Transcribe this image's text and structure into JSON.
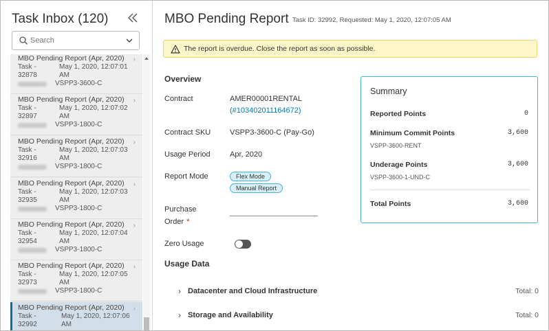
{
  "sidebar": {
    "title": "Task Inbox (120)",
    "collapse_icon": "double-chevron-left-icon",
    "search": {
      "placeholder": "Search",
      "value": ""
    },
    "tasks": [
      {
        "title": "MBO Pending Report (Apr, 2020)",
        "task": "Task - 32878",
        "date": "May 1, 2020, 12:07:01 AM",
        "sku": "VSPP3-3600-C",
        "active": false
      },
      {
        "title": "MBO Pending Report (Apr, 2020)",
        "task": "Task - 32897",
        "date": "May 1, 2020, 12:07:02 AM",
        "sku": "VSPP3-1800-C",
        "active": false
      },
      {
        "title": "MBO Pending Report (Apr, 2020)",
        "task": "Task - 32916",
        "date": "May 1, 2020, 12:07:03 AM",
        "sku": "VSPP3-1800-C",
        "active": false
      },
      {
        "title": "MBO Pending Report (Apr, 2020)",
        "task": "Task - 32935",
        "date": "May 1, 2020, 12:07:03 AM",
        "sku": "VSPP3-1800-C",
        "active": false
      },
      {
        "title": "MBO Pending Report (Apr, 2020)",
        "task": "Task - 32954",
        "date": "May 1, 2020, 12:07:04 AM",
        "sku": "VSPP3-1800-C",
        "active": false
      },
      {
        "title": "MBO Pending Report (Apr, 2020)",
        "task": "Task - 32973",
        "date": "May 1, 2020, 12:07:05 AM",
        "sku": "VSPP3-1800-C",
        "active": false
      },
      {
        "title": "MBO Pending Report (Apr, 2020)",
        "task": "Task - 32992",
        "date": "May 1, 2020, 12:07:06 AM",
        "sku": "",
        "active": true
      }
    ]
  },
  "main": {
    "title": "MBO Pending Report",
    "meta": "Task ID: 32992, Requested: May 1, 2020, 12:07:05 AM",
    "alert": "The report is overdue. Close the report as soon as possible.",
    "overview": {
      "title": "Overview",
      "contract_label": "Contract",
      "contract_value": "AMER00001RENTAL",
      "contract_link": "(#103402011164672)",
      "sku_label": "Contract SKU",
      "sku_value": "VSPP3-3600-C (Pay-Go)",
      "period_label": "Usage Period",
      "period_value": "Apr, 2020",
      "mode_label": "Report Mode",
      "mode_pills": [
        "Flex Mode",
        "Manual Report"
      ],
      "po_label_1": "Purchase",
      "po_label_2": "Order",
      "po_required": "*",
      "po_value": "",
      "zero_label": "Zero Usage"
    },
    "usage": {
      "title": "Usage Data",
      "rows": [
        {
          "label": "Datacenter and Cloud Infrastructure",
          "total": "Total: 0"
        },
        {
          "label": "Storage and Availability",
          "total": "Total: 0"
        }
      ]
    },
    "summary": {
      "title": "Summary",
      "reported_label": "Reported Points",
      "reported_value": "0",
      "min_label": "Minimum Commit Points",
      "min_value": "3,600",
      "min_sub": "VSPP-3600-RENT",
      "under_label": "Underage Points",
      "under_value": "3,600",
      "under_sub": "VSPP-3600-1-UND-C",
      "total_label": "Total Points",
      "total_value": "3,600"
    }
  },
  "colors": {
    "accent": "#0079b8",
    "alert_bg": "#fdf6c8",
    "active_task_bg": "#d2dfe9",
    "pill_bg": "#d7f0f8"
  }
}
